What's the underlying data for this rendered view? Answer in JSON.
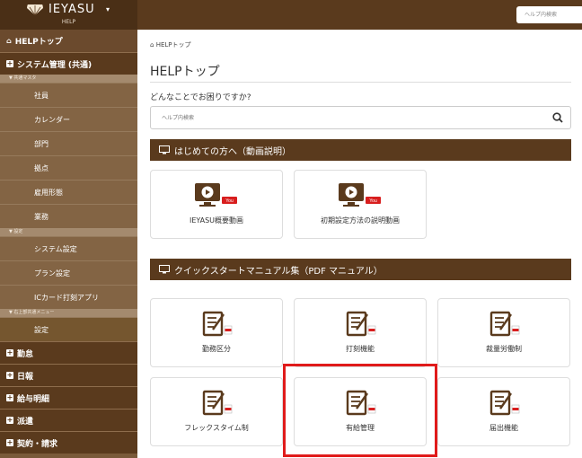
{
  "header": {
    "brand": "IEYASU",
    "caret": "▾",
    "sub": "HELP",
    "search_placeholder": "ヘルプ内検索"
  },
  "sidebar": {
    "top": {
      "icon": "home-icon",
      "label": "HELPトップ"
    },
    "system": "システム管理 (共通)",
    "groups": [
      {
        "label": "▼ 共通マスタ",
        "items": [
          "社員",
          "カレンダー",
          "部門",
          "拠点",
          "雇用形態",
          "業務"
        ]
      },
      {
        "label": "▼ 設定",
        "items": [
          "システム設定",
          "プラン設定",
          "ICカード打刻アプリ"
        ]
      },
      {
        "label": "▼ 右上部共通メニュー",
        "items": [
          "設定"
        ]
      }
    ],
    "sections": [
      "勤怠",
      "日報",
      "給与明細",
      "派遣",
      "契約・請求"
    ]
  },
  "main": {
    "breadcrumb": "HELPトップ",
    "title": "HELPトップ",
    "question": "どんなことでお困りですか?",
    "search_placeholder": "ヘルプ内検索",
    "sections": [
      {
        "title": "はじめての方へ（動画説明）",
        "cards": [
          {
            "label": "IEYASU概要動画",
            "icon": "video-icon"
          },
          {
            "label": "初期設定方法の説明動画",
            "icon": "video-icon"
          }
        ]
      },
      {
        "title": "クイックスタートマニュアル集（PDF マニュアル）",
        "cards": [
          {
            "label": "勤務区分",
            "icon": "pdf-document-icon"
          },
          {
            "label": "打刻機能",
            "icon": "pdf-document-icon"
          },
          {
            "label": "裁量労働制",
            "icon": "pdf-document-icon"
          },
          {
            "label": "フレックスタイム制",
            "icon": "pdf-document-icon"
          },
          {
            "label": "有給管理",
            "icon": "pdf-document-icon"
          },
          {
            "label": "届出機能",
            "icon": "pdf-document-icon"
          }
        ]
      }
    ]
  },
  "colors": {
    "brand_brown": "#5a3a1d",
    "sidebar_brown": "#7a5a3a",
    "highlight_red": "#e01b1b",
    "youtube_red": "#d81e1e"
  }
}
